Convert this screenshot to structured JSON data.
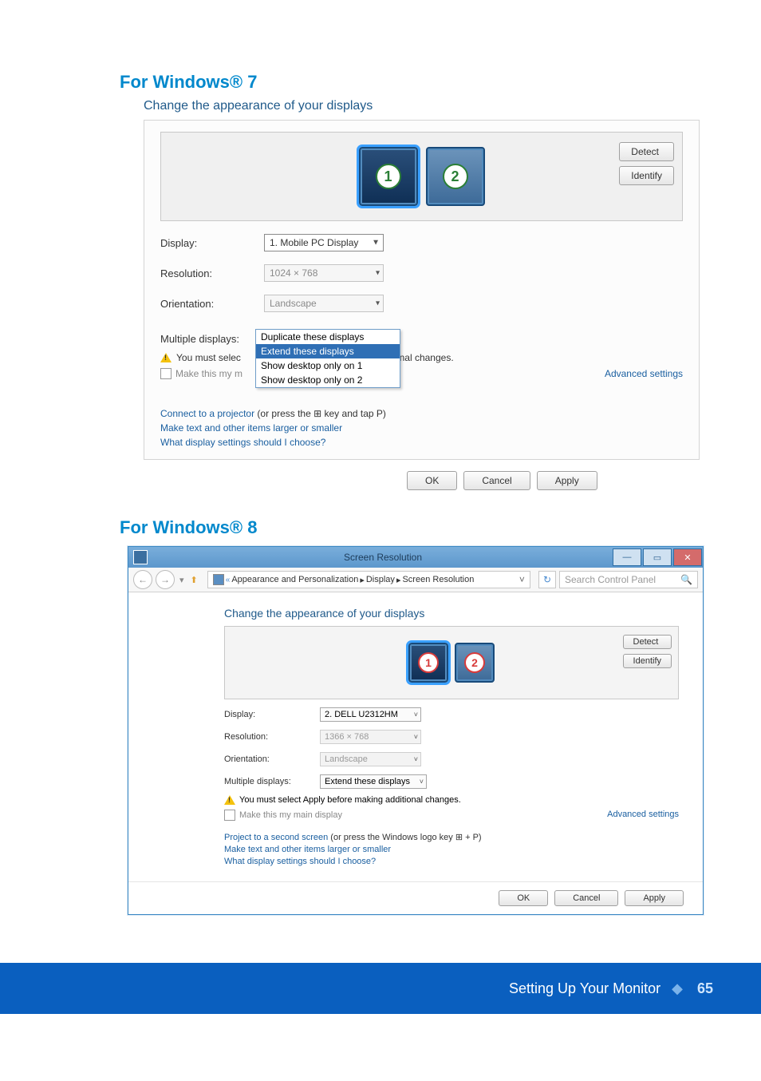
{
  "section1": {
    "heading": "For Windows® 7"
  },
  "section2": {
    "heading": "For Windows® 8"
  },
  "win7": {
    "title": "Change the appearance of your displays",
    "monitor_numbers": [
      "1",
      "2"
    ],
    "detect": "Detect",
    "identify": "Identify",
    "labels": {
      "display": "Display:",
      "resolution": "Resolution:",
      "orientation": "Orientation:",
      "multiple": "Multiple displays:"
    },
    "values": {
      "display": "1. Mobile PC Display",
      "resolution": "1024 × 768",
      "orientation": "Landscape",
      "multiple": "Extend these displays"
    },
    "dropdown_options": [
      "Duplicate these displays",
      "Extend these displays",
      "Show desktop only on 1",
      "Show desktop only on 2"
    ],
    "warn_left": "You must selec",
    "warn_right": "onal changes.",
    "make_main": "Make this my m",
    "advanced": "Advanced settings",
    "link_projector_a": "Connect to a projector",
    "link_projector_b": " (or press the ",
    "link_projector_c": " key and tap P)",
    "link_text": "Make text and other items larger or smaller",
    "link_what": "What display settings should I choose?",
    "ok": "OK",
    "cancel": "Cancel",
    "apply": "Apply"
  },
  "win8": {
    "window_title": "Screen Resolution",
    "breadcrumb": {
      "a": "Appearance and Personalization",
      "b": "Display",
      "c": "Screen Resolution",
      "laquo": "«"
    },
    "search_placeholder": "Search Control Panel",
    "subtitle": "Change the appearance of your displays",
    "monitor_numbers": [
      "1",
      "2"
    ],
    "detect": "Detect",
    "identify": "Identify",
    "labels": {
      "display": "Display:",
      "resolution": "Resolution:",
      "orientation": "Orientation:",
      "multiple": "Multiple displays:"
    },
    "values": {
      "display": "2. DELL U2312HM",
      "resolution": "1366 × 768",
      "orientation": "Landscape",
      "multiple": "Extend these displays"
    },
    "warn": "You must select Apply before making additional changes.",
    "make_main": "Make this my main display",
    "advanced": "Advanced settings",
    "link_project_a": "Project to a second screen",
    "link_project_b": " (or press the Windows logo key ",
    "link_project_c": " + P)",
    "link_text": "Make text and other items larger or smaller",
    "link_what": "What display settings should I choose?",
    "ok": "OK",
    "cancel": "Cancel",
    "apply": "Apply"
  },
  "footer": {
    "text": "Setting Up Your Monitor",
    "page": "65"
  }
}
